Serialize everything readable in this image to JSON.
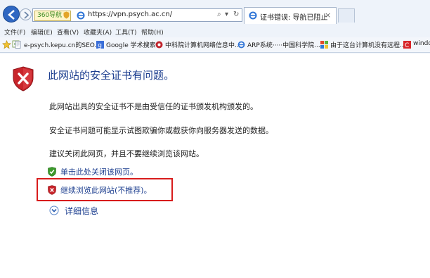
{
  "browser": {
    "address_bar": {
      "badge": "360导航",
      "url": "https://vpn.psych.ac.cn/"
    },
    "tab": {
      "title": "证书错误: 导航已阻止"
    },
    "menu": [
      "文件(F)",
      "编辑(E)",
      "查看(V)",
      "收藏夹(A)",
      "工具(T)",
      "帮助(H)"
    ],
    "favorites": [
      {
        "label": "e-psych.kepu.cn的SEO...",
        "icon": "document-icon"
      },
      {
        "label": "Google 学术搜索",
        "icon": "google-icon"
      },
      {
        "label": "中科院计算机网络信息中...",
        "icon": "cas-icon"
      },
      {
        "label": "ARP系统·····中国科学院...",
        "icon": "ie-icon"
      },
      {
        "label": "由于这台计算机没有远程...",
        "icon": "windows-icon"
      },
      {
        "label": "windo",
        "icon": "c-icon"
      }
    ]
  },
  "page": {
    "title": "此网站的安全证书有问题。",
    "paragraphs": [
      "此网站出具的安全证书不是由受信任的证书颁发机构颁发的。",
      "安全证书问题可能显示试图欺骗你或截获你向服务器发送的数据。",
      "建议关闭此网页，并且不要继续浏览该网站。"
    ],
    "close_link": "单击此处关闭该网页。",
    "continue_link": "继续浏览此网站(不推荐)。",
    "details_link": "详细信息"
  },
  "colors": {
    "link": "#1a3c8e",
    "highlight_box": "#d81c1c",
    "shield_red": "#c8252b",
    "shield_green": "#3c9a2c"
  }
}
